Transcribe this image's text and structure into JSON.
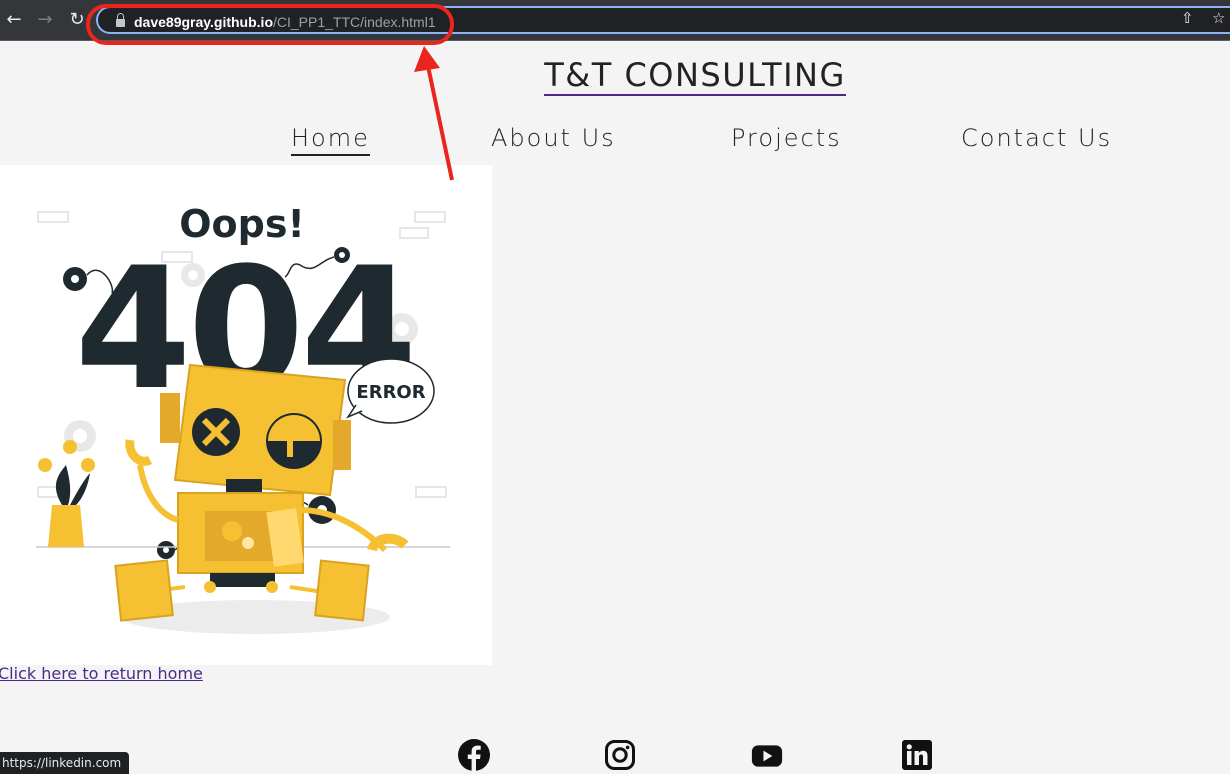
{
  "browser": {
    "url_host": "dave89gray.github.io",
    "url_path": "/CI_PP1_TTC/index.html1",
    "back_icon": "back-arrow-icon",
    "forward_icon": "forward-arrow-icon",
    "reload_icon": "reload-icon"
  },
  "site": {
    "title": "T&T CONSULTING",
    "nav": [
      "Home",
      "About Us",
      "Projects",
      "Contact Us"
    ]
  },
  "error": {
    "heading": "Oops!",
    "code": "404",
    "bubble": "ERROR",
    "return_link": "Click here to return home"
  },
  "footer": {
    "icons": [
      "facebook-icon",
      "instagram-icon",
      "youtube-icon",
      "linkedin-icon"
    ]
  },
  "status_bar": {
    "text": "https://linkedin.com"
  },
  "colors": {
    "annotation": "#e8261e",
    "robot_yellow": "#f5c132",
    "dark_text": "#1e2a2f",
    "link_purple": "#4b2a8a"
  }
}
